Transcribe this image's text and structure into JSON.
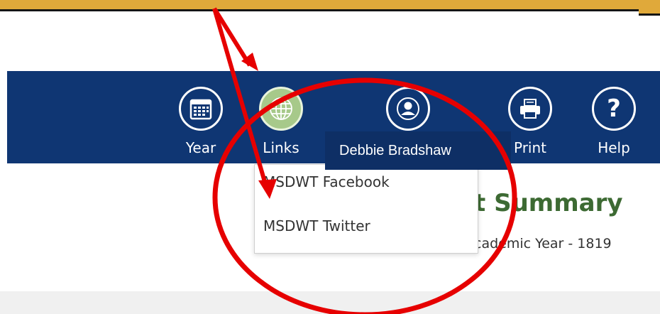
{
  "nav": {
    "items": [
      {
        "id": "year",
        "label": "Year",
        "icon": "calendar-icon"
      },
      {
        "id": "links",
        "label": "Links",
        "icon": "globe-icon"
      },
      {
        "id": "profile",
        "label": "",
        "icon": "user-icon"
      },
      {
        "id": "print",
        "label": "Print",
        "icon": "printer-icon"
      },
      {
        "id": "help",
        "label": "Help",
        "icon": "question-icon"
      }
    ]
  },
  "user_tooltip": {
    "name": "Debbie Bradshaw"
  },
  "links_menu": {
    "items": [
      {
        "label": "MSDWT Facebook"
      },
      {
        "label": "MSDWT Twitter"
      }
    ]
  },
  "page": {
    "title": "t Summary",
    "subtitle": "cademic Year - 1819"
  },
  "colors": {
    "nav_background": "#0f3673",
    "tooltip_background": "#0e2f65",
    "title_green": "#3d6a33",
    "annotation_red": "#e60000",
    "top_strip": "#e0a93a"
  }
}
